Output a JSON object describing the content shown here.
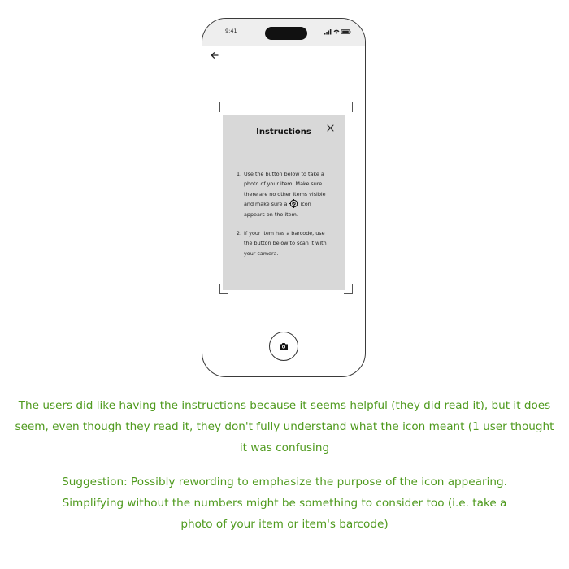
{
  "phone": {
    "status_time": "9:41",
    "back_icon": "arrow-left-icon",
    "modal": {
      "title": "Instructions",
      "close_icon": "close-icon",
      "items": [
        {
          "number": "1.",
          "text_before_icon": "Use the button below to take a photo of your item. Make sure there are no other items visible and make sure a",
          "icon": "item-detected-icon",
          "text_after_icon": "icon appears on the item."
        },
        {
          "number": "2.",
          "text": "If your item has a barcode, use the button below to scan it with your camera."
        }
      ]
    },
    "camera_button_icon": "camera-icon"
  },
  "feedback": {
    "observation": "The users did like having the instructions because it seems helpful (they did read it), but it does seem, even though they read it, they don't fully understand what the icon meant (1 user thought it was confusing",
    "suggestion": "Suggestion: Possibly rewording to emphasize the purpose of the icon appearing. Simplifying without the numbers might be something to consider too (i.e. take a photo of your item or item's barcode)"
  },
  "colors": {
    "feedback_text": "#4f9a1e",
    "modal_bg": "#d8d8d8"
  }
}
